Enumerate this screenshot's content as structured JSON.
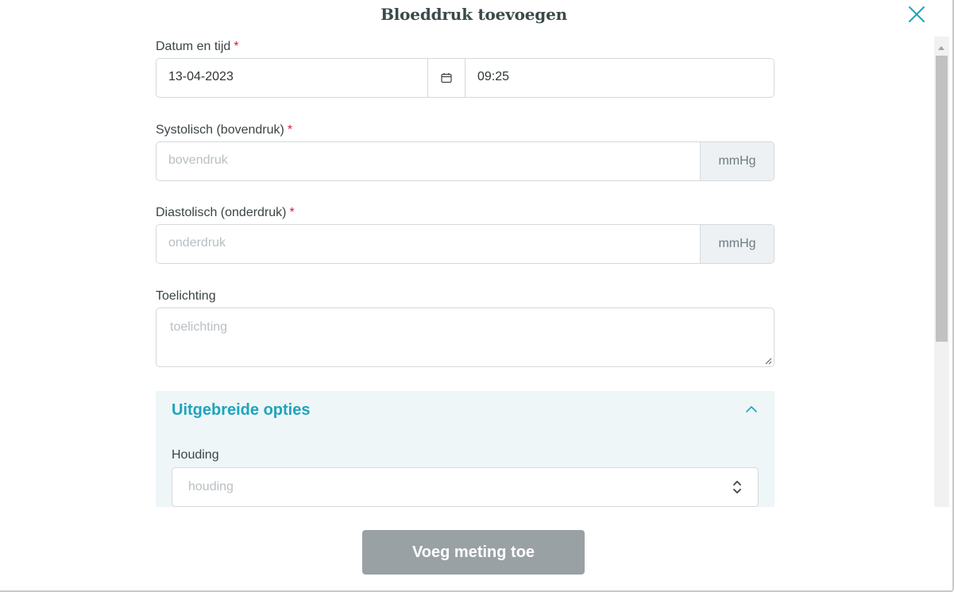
{
  "modal": {
    "title": "Bloeddruk toevoegen",
    "close_icon": "close-icon"
  },
  "form": {
    "datetime": {
      "label": "Datum en tijd",
      "required_marker": "*",
      "date_value": "13-04-2023",
      "calendar_icon": "calendar-icon",
      "time_value": "09:25"
    },
    "systolic": {
      "label": "Systolisch (bovendruk)",
      "required_marker": "*",
      "placeholder": "bovendruk",
      "unit": "mmHg"
    },
    "diastolic": {
      "label": "Diastolisch (onderdruk)",
      "required_marker": "*",
      "placeholder": "onderdruk",
      "unit": "mmHg"
    },
    "note": {
      "label": "Toelichting",
      "placeholder": "toelichting"
    },
    "advanced": {
      "title": "Uitgebreide opties",
      "toggle_icon": "chevron-up-icon",
      "expanded": true,
      "posture": {
        "label": "Houding",
        "placeholder": "houding",
        "icon": "select-updown-icon"
      }
    }
  },
  "footer": {
    "submit_label": "Voeg meting toe",
    "submit_enabled": false
  },
  "colors": {
    "accent": "#1fa4bb",
    "required": "#d0213a",
    "button_disabled": "#9aa1a5",
    "advanced_bg": "#eef6f8"
  }
}
